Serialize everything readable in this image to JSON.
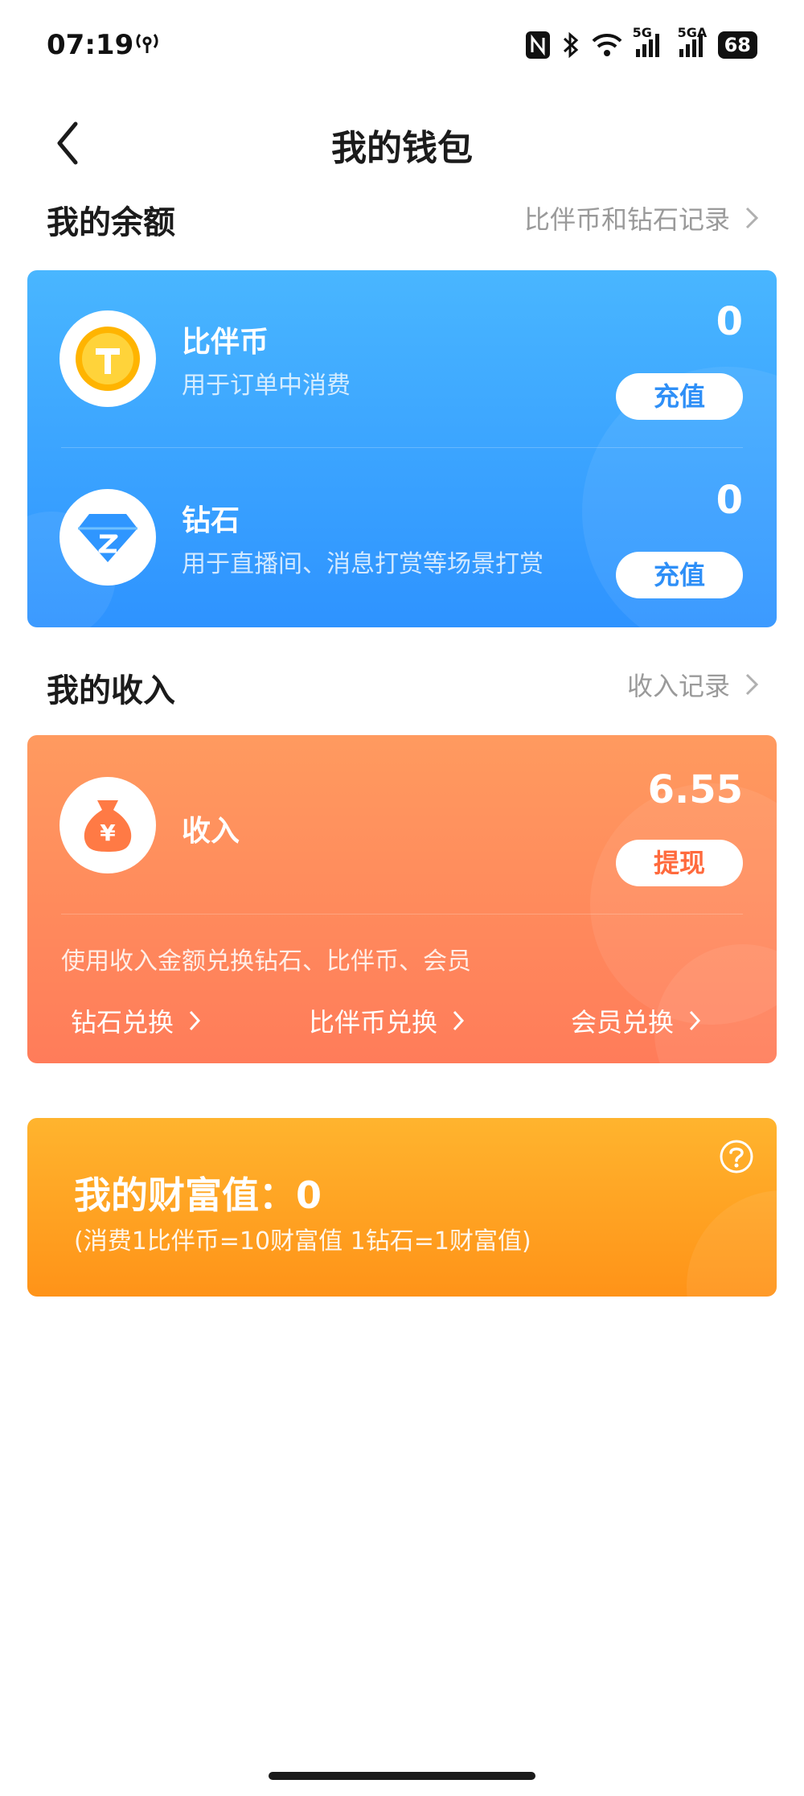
{
  "status_bar": {
    "time": "07:19",
    "network_1": "5G",
    "network_2": "5GA",
    "battery": "68"
  },
  "header": {
    "title": "我的钱包"
  },
  "balance_section": {
    "title": "我的余额",
    "link": "比伴币和钻石记录",
    "items": [
      {
        "name": "比伴币",
        "desc": "用于订单中消费",
        "amount": "0",
        "button": "充值",
        "icon": "coin-icon",
        "icon_letter": "T"
      },
      {
        "name": "钻石",
        "desc": "用于直播间、消息打赏等场景打赏",
        "amount": "0",
        "button": "充值",
        "icon": "diamond-icon",
        "icon_letter": "Z"
      }
    ]
  },
  "income_section": {
    "title": "我的收入",
    "link": "收入记录",
    "name": "收入",
    "amount": "6.55",
    "button": "提现",
    "icon_letter": "¥",
    "note": "使用收入金额兑换钻石、比伴币、会员",
    "exchanges": [
      "钻石兑换",
      "比伴币兑换",
      "会员兑换"
    ]
  },
  "wealth": {
    "title": "我的财富值：0",
    "rule": "(消费1比伴币=10财富值 1钻石=1财富值)"
  },
  "colors": {
    "balance_card": "#3aa2ff",
    "income_card": "#ff8a5c",
    "wealth_card": "#ffa322"
  }
}
